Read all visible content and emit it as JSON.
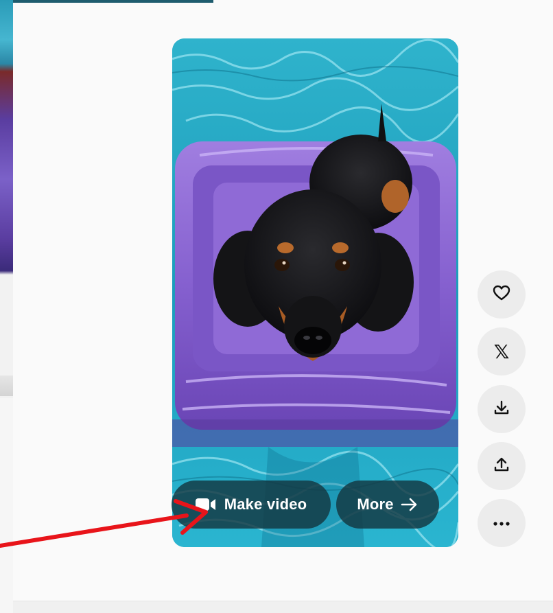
{
  "media_card": {
    "make_video_label": "Make video",
    "more_label": "More",
    "icons": {
      "video": "video-camera-icon",
      "more_arrow": "arrow-right-icon"
    }
  },
  "side_actions": [
    {
      "icon": "heart-icon"
    },
    {
      "icon": "x-logo-icon",
      "glyph": "𝕏"
    },
    {
      "icon": "download-icon"
    },
    {
      "icon": "upload-share-icon"
    },
    {
      "icon": "more-dots-icon"
    }
  ],
  "colors": {
    "pill_bg": "#14373f",
    "side_button_bg": "#ececec",
    "annotation_arrow": "#e8141a",
    "float_purple": "#8a63d2",
    "water": "#2aa7c4"
  }
}
